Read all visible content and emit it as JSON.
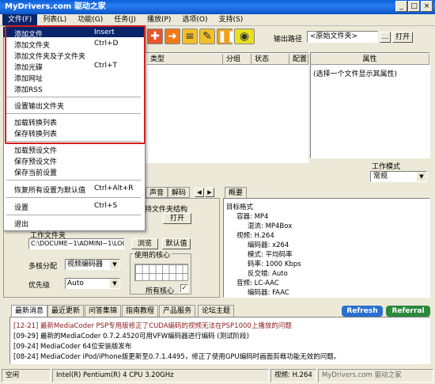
{
  "title": "MyDrivers.com 驱动之家",
  "menu": [
    "文件(F)",
    "列表(L)",
    "功能(G)",
    "任务(J)",
    "播放(P)",
    "选项(O)",
    "支持(S)"
  ],
  "output_path": {
    "label": "输出路径",
    "value": "<原始文件夹>",
    "browse": "...",
    "open": "打开"
  },
  "file_menu": {
    "items": [
      {
        "label": "添加文件",
        "shortcut": "Insert"
      },
      {
        "label": "添加文件夹",
        "shortcut": "Ctrl+D"
      },
      {
        "label": "添加文件夹及子文件夹",
        "shortcut": ""
      },
      {
        "label": "添加光碟",
        "shortcut": "Ctrl+T"
      },
      {
        "label": "添加网址",
        "shortcut": ""
      },
      {
        "label": "添加RSS",
        "shortcut": ""
      },
      {
        "label": "设置输出文件夹",
        "shortcut": ""
      },
      {
        "label": "加载转换列表",
        "shortcut": ""
      },
      {
        "label": "保存转换列表",
        "shortcut": ""
      },
      {
        "label": "加载预设文件",
        "shortcut": ""
      },
      {
        "label": "保存预设文件",
        "shortcut": ""
      },
      {
        "label": "保存当前设置",
        "shortcut": ""
      },
      {
        "label": "恢复所有设置为默认值",
        "shortcut": "Ctrl+Alt+R"
      },
      {
        "label": "设置",
        "shortcut": "Ctrl+S"
      },
      {
        "label": "退出",
        "shortcut": ""
      }
    ]
  },
  "list_headers": [
    "类型",
    "分组",
    "状态",
    "配置"
  ],
  "properties": {
    "header": "属性",
    "hint": "(选择一个文件显示其属性)"
  },
  "work_mode": {
    "label": "工作模式",
    "value": "常规"
  },
  "tabs_mid": [
    "声音",
    "解码"
  ],
  "panel": {
    "keep_structure": "持文件夹结构",
    "open": "打开",
    "work_folder": "工作文件夹",
    "folder_path": "C:\\DOCUME~1\\ADMINI~1\\LOC",
    "browse": "浏览",
    "default": "默认值",
    "multicore_label": "多核分配",
    "multicore_value": "视频编码器",
    "cores_label": "使用的核心",
    "all_cores": "所有核心",
    "priority_label": "优先级",
    "priority_value": "Auto"
  },
  "overview_tab": "概要",
  "tree": [
    "目标格式",
    "容器: MP4",
    "混流: MP4Box",
    "视频: H.264",
    "编码器: x264",
    "模式: 平均码率",
    "码率: 1000 Kbps",
    "反交错: Auto",
    "音频: LC-AAC",
    "编码器: FAAC"
  ],
  "news_tabs": [
    "最新消息",
    "最近更新",
    "问答集锦",
    "指南教程",
    "产品服务",
    "论坛主题"
  ],
  "refresh": "Refresh",
  "referral": "Referral",
  "news": [
    "[12-21] 最新MediaCoder PSP专用版修正了CUDA编码的视频无法在PSP1000上播放的问题",
    "[09-29] 最新的MediaCoder 0.7.2.4520可用VFW编码器进行编码 (测试阶段)",
    "[09-24] MediaCoder 64位安装版发布",
    "[08-24] MediaCoder iPod/iPhone版更新至0.7.1.4495，修正了使用GPU编码时画面剪裁功能无效的问题。"
  ],
  "status": {
    "state": "空闲",
    "cpu": "Intel(R) Pentium(R) 4 CPU 3.20GHz",
    "video": "视频: H.264",
    "watermark": "MyDrivers.com 驱动之家"
  },
  "colors": {
    "title_bar": "#0a5fd8",
    "menu_highlight": "#0a246a",
    "red_box": "#d21f1f",
    "refresh": "#2a6fd0",
    "referral": "#2a8a3a"
  }
}
